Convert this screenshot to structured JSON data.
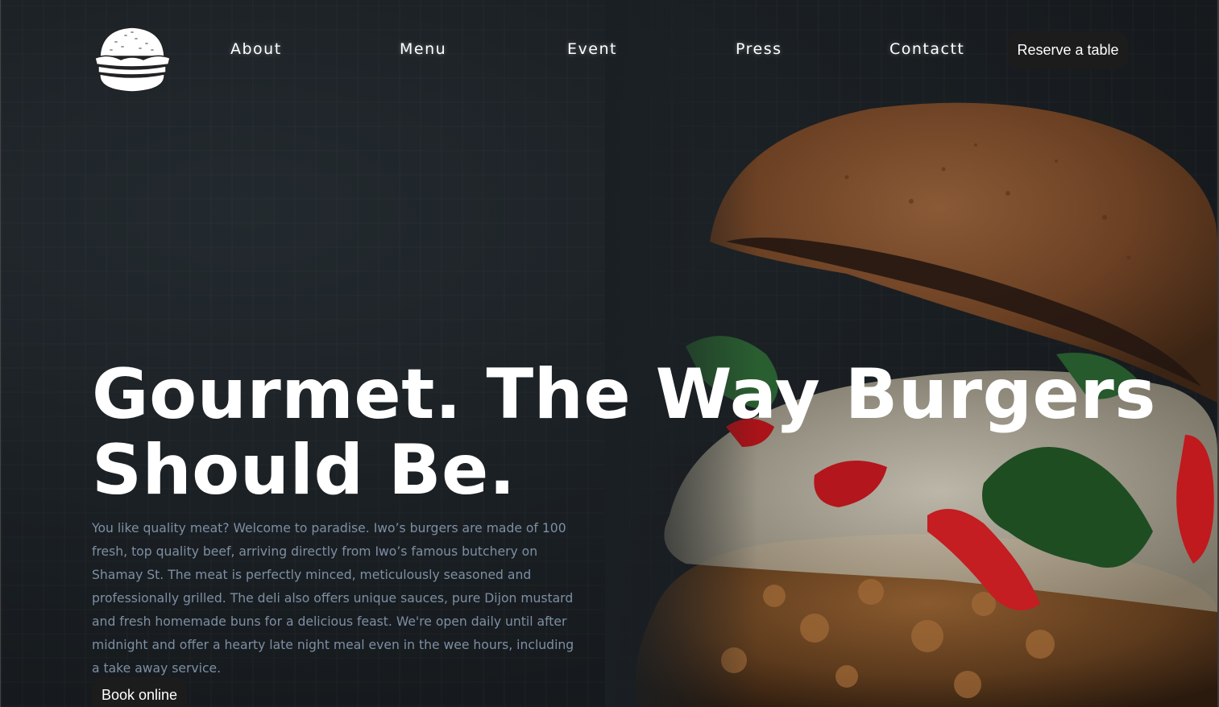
{
  "brand": {
    "logo_icon": "burger-logo-icon"
  },
  "nav": {
    "items": [
      {
        "label": "About"
      },
      {
        "label": "Menu"
      },
      {
        "label": "Event"
      },
      {
        "label": "Press"
      },
      {
        "label": "Contactt"
      }
    ],
    "cta_label": "Reserve a table"
  },
  "hero": {
    "title_line1": "Gourmet. The Way Burgers",
    "title_line2": "Should Be.",
    "description": "You like quality meat? Welcome to paradise. Iwo’s burgers are made of 100 fresh, top quality beef, arriving directly from Iwo’s famous butchery on Shamay St. The meat is perfectly minced, meticulously seasoned and professionally grilled. The deli also offers unique sauces, pure Dijon mustard and fresh homemade buns for a delicious feast. We're open daily until after midnight and offer a hearty late night meal even in the wee hours, including a take away service.",
    "book_label": "Book online",
    "image_icon": "burger-photo"
  },
  "colors": {
    "background": "#15191c",
    "button_bg": "#1c1c1c",
    "text_primary": "#ffffff",
    "text_muted": "#7d8fa3"
  }
}
